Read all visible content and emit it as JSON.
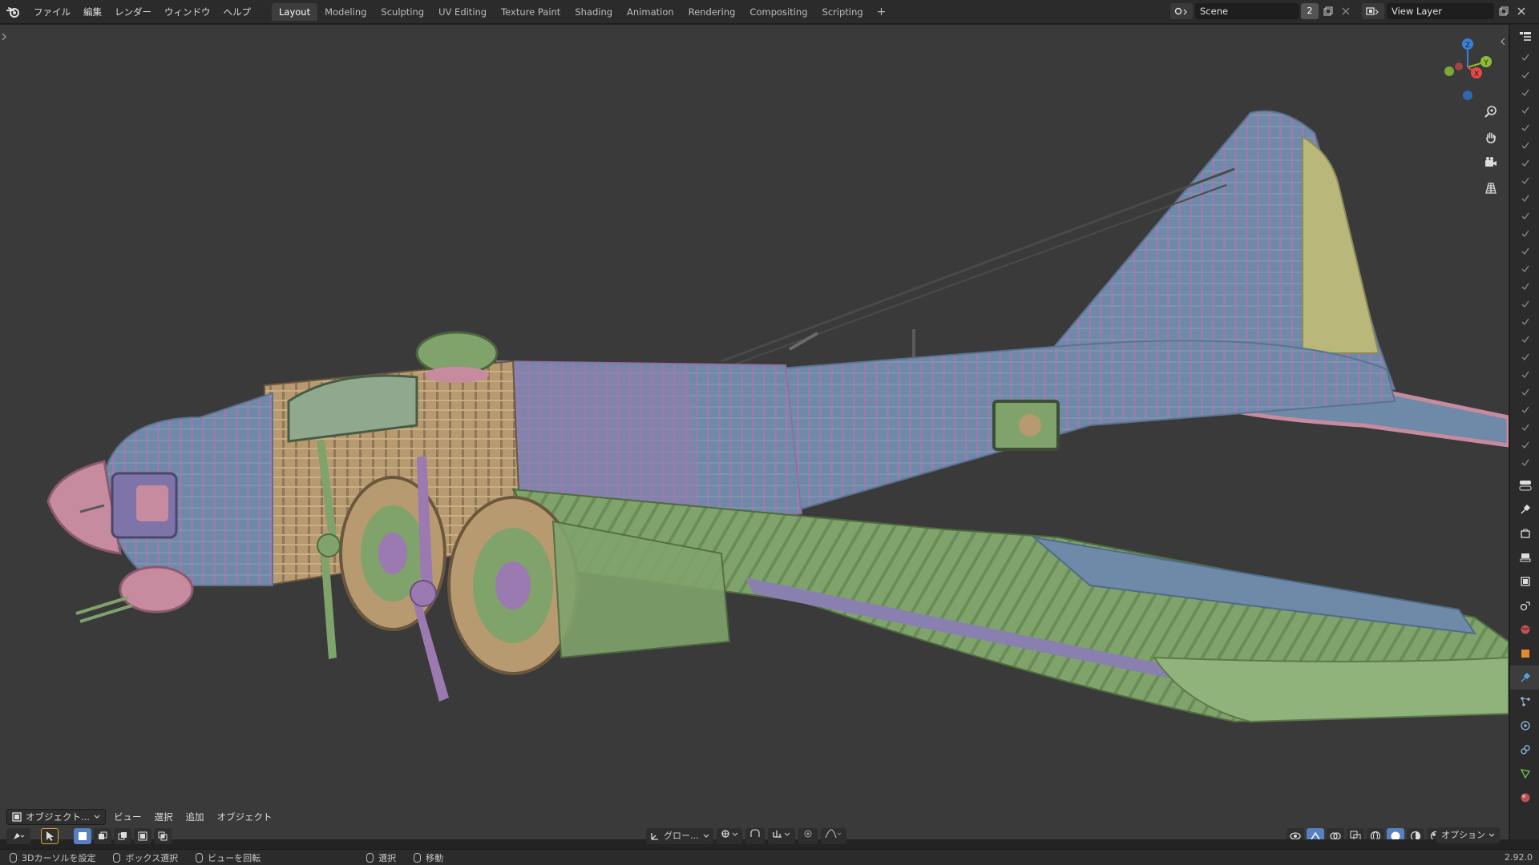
{
  "menus": [
    "ファイル",
    "編集",
    "レンダー",
    "ウィンドウ",
    "ヘルプ"
  ],
  "workspaces": [
    {
      "label": "Layout",
      "active": true
    },
    {
      "label": "Modeling",
      "active": false
    },
    {
      "label": "Sculpting",
      "active": false
    },
    {
      "label": "UV Editing",
      "active": false
    },
    {
      "label": "Texture Paint",
      "active": false
    },
    {
      "label": "Shading",
      "active": false
    },
    {
      "label": "Animation",
      "active": false
    },
    {
      "label": "Rendering",
      "active": false
    },
    {
      "label": "Compositing",
      "active": false
    },
    {
      "label": "Scripting",
      "active": false
    }
  ],
  "add_workspace": "+",
  "scene": {
    "name": "Scene",
    "users": "2"
  },
  "view_layer": {
    "name": "View Layer"
  },
  "viewport_header": {
    "mode": "オブジェクト...",
    "menus": [
      "ビュー",
      "選択",
      "追加",
      "オブジェクト"
    ]
  },
  "transform_orientation": "グロー...",
  "options_label": "オプション",
  "gizmo": {
    "z": "Z",
    "y": "Y",
    "x": "X"
  },
  "statusbar": {
    "items": [
      "3Dカーソルを設定",
      "ボックス選択",
      "ビューを回転",
      "選択",
      "移動"
    ],
    "version": "2.92.0"
  },
  "colors": {
    "accent": "#5680c2",
    "axis_x": "#e04a4a",
    "axis_y": "#8bbd36",
    "axis_z": "#3b7fd6",
    "mesh_green": "#7fa36b",
    "mesh_blue": "#6f8aa8",
    "mesh_purple": "#9a7ab0",
    "mesh_tan": "#b89a70",
    "mesh_pink": "#c78ba0"
  }
}
